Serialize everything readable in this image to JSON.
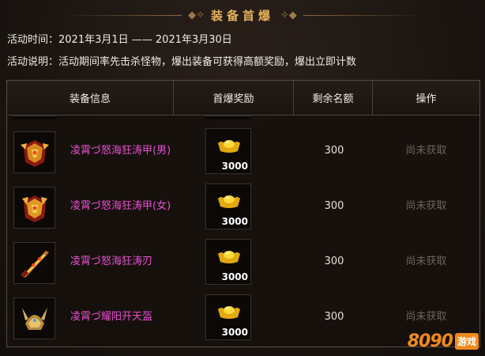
{
  "title": "装备首爆",
  "event_time_label": "活动时间：",
  "event_time_value": "2021年3月1日 —— 2021年3月30日",
  "event_desc_label": "活动说明：",
  "event_desc_value": "活动期间率先击杀怪物，爆出装备可获得高额奖励，爆出立即计数",
  "table": {
    "headers": [
      "装备信息",
      "首爆奖励",
      "剩余名额",
      "操作"
    ],
    "rows": [
      {
        "item_name": "凌霄づ怒海狂涛甲(男)",
        "reward": "3000",
        "remaining": "300",
        "status": "尚未获取",
        "icon": "armor-icon"
      },
      {
        "item_name": "凌霄づ怒海狂涛甲(女)",
        "reward": "3000",
        "remaining": "300",
        "status": "尚未获取",
        "icon": "armor-icon"
      },
      {
        "item_name": "凌霄づ怒海狂涛刃",
        "reward": "3000",
        "remaining": "300",
        "status": "尚未获取",
        "icon": "blade-icon"
      },
      {
        "item_name": "凌霄づ耀阳开天盔",
        "reward": "3000",
        "remaining": "300",
        "status": "尚未获取",
        "icon": "helmet-icon"
      }
    ]
  },
  "watermark": {
    "number": "8090",
    "badge": "游戏"
  },
  "colors": {
    "title": "#e7b25a",
    "item_name": "#e74fd1",
    "status": "#6e6457",
    "gold": "#f5c21b"
  }
}
